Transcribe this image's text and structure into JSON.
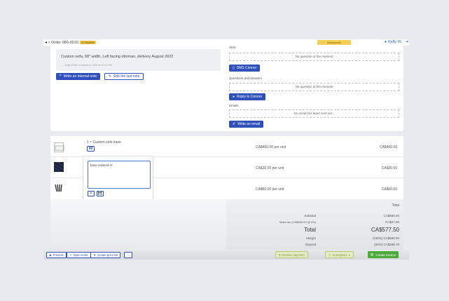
{
  "topbar": {
    "order_label": "Order 080-0010",
    "order_badge": "Complete",
    "status_pill": "Bluesomes",
    "user_name": "Kelly W."
  },
  "notes": {
    "text": "Custom sofa, 68\" width, Left facing ottoman, delivery August 2022",
    "meta": "— Kelly White on March 8, 2022 at 12:17 PM",
    "write_internal_note": "Write an internal note",
    "edit_last_note": "Edit the last note"
  },
  "communications": {
    "sms_label": "SMS",
    "sms_empty": "No question at the moment",
    "sms_button": "SMS Connor",
    "qa_label": "Questions and answers",
    "qa_empty": "No question at the moment",
    "qa_button": "Reply to Connor",
    "emails_label": "Emails",
    "emails_empty": "No email has been sent yet...",
    "email_button": "Write an email"
  },
  "line_items": [
    {
      "title": "1 × Custom sofa base",
      "note_button": "99",
      "price": "CA$460.00 per unit",
      "total": "CA$460.00"
    },
    {
      "title": "",
      "price": "CA$30.00 per unit",
      "total": "CA$30.00"
    },
    {
      "title": "",
      "price": "CA$60.00 per unit",
      "total": "CA$60.00"
    }
  ],
  "note_popup": {
    "text": "base ordered ✉",
    "cancel": "✕",
    "save": "💾"
  },
  "summary": {
    "header": "Total",
    "subtotal_label": "Subtotal",
    "subtotal_value": "CA$550.00",
    "tax_label": "Sales tax (CA$550.00 @ 5%)",
    "tax_value": "CA$27.50",
    "total_label": "Total",
    "total_value": "CA$577.50",
    "margin_label": "Margin",
    "margin_value": "(100%) CA$550.00",
    "deposit_label": "Deposit",
    "deposit_value": "(50%) CA$288.75"
  },
  "actions": {
    "preview": "Preview",
    "open_order": "Open order",
    "create_price_list": "Create price list",
    "more": "···",
    "receive_payment": "Receive payment",
    "in_progress": "In progress",
    "create_invoice": "Create invoice"
  },
  "colors": {
    "primary_blue": "#2f4fba",
    "badge_yellow": "#f2c94c",
    "invoice_green": "#4caa3a",
    "olive": "#8a9a2e"
  }
}
